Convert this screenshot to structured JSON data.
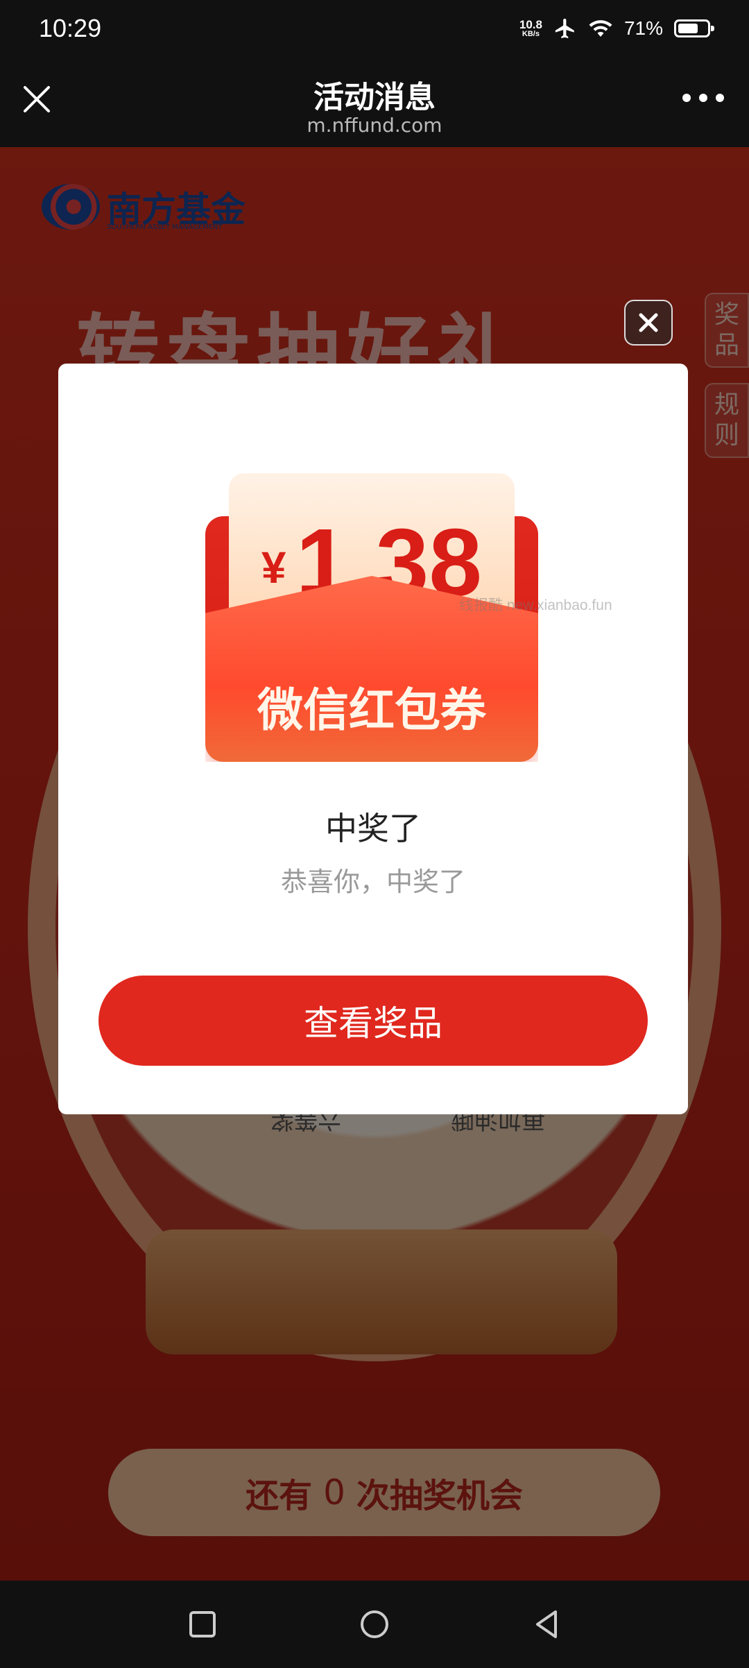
{
  "status_bar": {
    "time": "10:29",
    "net_speed_value": "10.8",
    "net_speed_unit": "KB/s",
    "battery": "71%",
    "battery_level": 0.71
  },
  "header": {
    "title": "活动消息",
    "url": "m.nffund.com"
  },
  "page": {
    "logo_text": "南方基金",
    "logo_sub": "SOUTHERN ASSET MANAGEMENT",
    "headline": "转盘抽好礼",
    "side_tabs": [
      "奖品",
      "规则"
    ],
    "wheel_labels": [
      "六等奖",
      "再加油哦"
    ],
    "chances_prefix": "还有",
    "chances_count": "0",
    "chances_suffix": "次抽奖机会"
  },
  "modal": {
    "currency": "¥",
    "amount": "1.38",
    "coupon_label": "微信红包券",
    "watermark": "线报酷 new.xianbao.fun",
    "title": "中奖了",
    "subtitle": "恭喜你，中奖了",
    "button": "查看奖品"
  },
  "colors": {
    "accent": "#e0281e",
    "modal_bg": "#ffffff"
  }
}
